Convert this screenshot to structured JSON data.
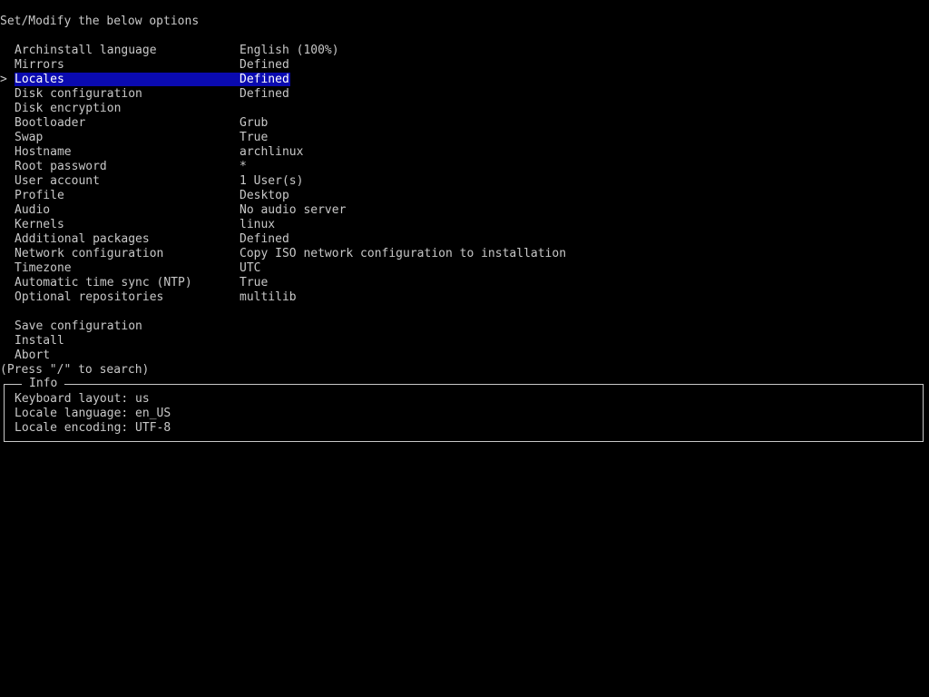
{
  "header": "Set/Modify the below options",
  "cursor_glyph": ">",
  "colors": {
    "background": "#000000",
    "text": "#c8c8c8",
    "selection": "#0a0ab0"
  },
  "menu": [
    {
      "label": "Archinstall language",
      "value": "English (100%)"
    },
    {
      "label": "Mirrors",
      "value": "Defined"
    },
    {
      "label": "Locales",
      "value": "Defined",
      "selected": true
    },
    {
      "label": "Disk configuration",
      "value": "Defined"
    },
    {
      "label": "Disk encryption",
      "value": ""
    },
    {
      "label": "Bootloader",
      "value": "Grub"
    },
    {
      "label": "Swap",
      "value": "True"
    },
    {
      "label": "Hostname",
      "value": "archlinux"
    },
    {
      "label": "Root password",
      "value": "*"
    },
    {
      "label": "User account",
      "value": "1 User(s)"
    },
    {
      "label": "Profile",
      "value": "Desktop"
    },
    {
      "label": "Audio",
      "value": "No audio server"
    },
    {
      "label": "Kernels",
      "value": "linux"
    },
    {
      "label": "Additional packages",
      "value": "Defined"
    },
    {
      "label": "Network configuration",
      "value": "Copy ISO network configuration to installation"
    },
    {
      "label": "Timezone",
      "value": "UTC"
    },
    {
      "label": "Automatic time sync (NTP)",
      "value": "True"
    },
    {
      "label": "Optional repositories",
      "value": "multilib"
    }
  ],
  "actions": {
    "save": "Save configuration",
    "install": "Install",
    "abort": "Abort"
  },
  "search_hint": "(Press \"/\" to search)",
  "info": {
    "title": "Info",
    "lines": [
      "Keyboard layout: us",
      "Locale language: en_US",
      "Locale encoding: UTF-8"
    ]
  }
}
